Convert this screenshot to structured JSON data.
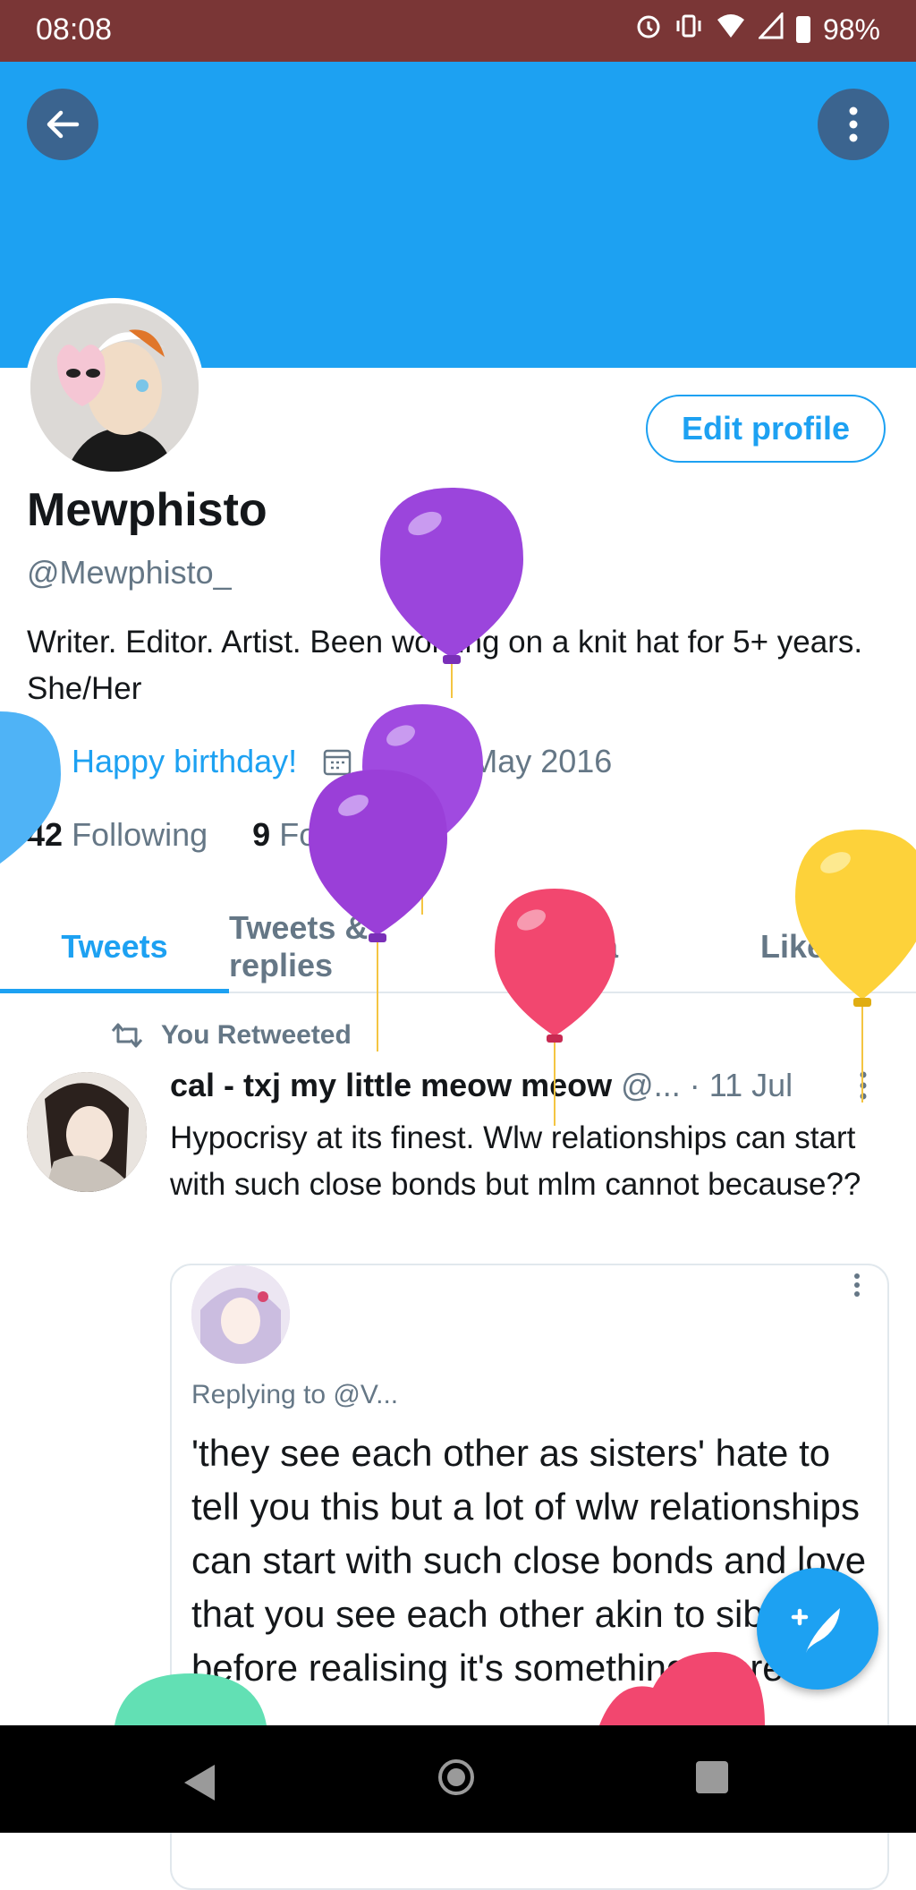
{
  "status_bar": {
    "time": "08:08",
    "battery": "98%"
  },
  "profile": {
    "edit_label": "Edit profile",
    "name": "Mewphisto",
    "handle": "@Mewphisto_",
    "bio": "Writer. Editor. Artist.  Been working on a knit hat for 5+ years. She/Her",
    "birthday": "Happy birthday!",
    "joined": "Joined May 2016",
    "following_count": "42",
    "following_label": "Following",
    "followers_count": "9",
    "followers_label": "Followers"
  },
  "tabs": [
    "Tweets",
    "Tweets & replies",
    "Media",
    "Likes"
  ],
  "timeline": {
    "retweet_label": "You Retweeted",
    "tweet": {
      "author": "cal - txj my little meow meow",
      "handle": "@...",
      "date": "· 11 Jul",
      "text": "Hypocrisy at its finest. Wlw relationships can start with such close bonds but mlm cannot because??",
      "quote": {
        "replying_to": "Replying to @V...",
        "text": "'they see each other as sisters' hate to tell you this but a lot of wlw relationships can start with such close bonds and love that you see each other akin to siblings before realising it's something more"
      }
    }
  },
  "colors": {
    "accent": "#1da1f2",
    "status_bar": "#7a3636",
    "text": "#14171a",
    "muted": "#657786"
  },
  "icons": [
    "back-arrow-icon",
    "more-vertical-icon",
    "alarm-icon",
    "vibrate-icon",
    "wifi-icon",
    "signal-icon",
    "battery-icon",
    "balloon-icon",
    "calendar-icon",
    "retweet-icon",
    "compose-tweet-icon"
  ]
}
